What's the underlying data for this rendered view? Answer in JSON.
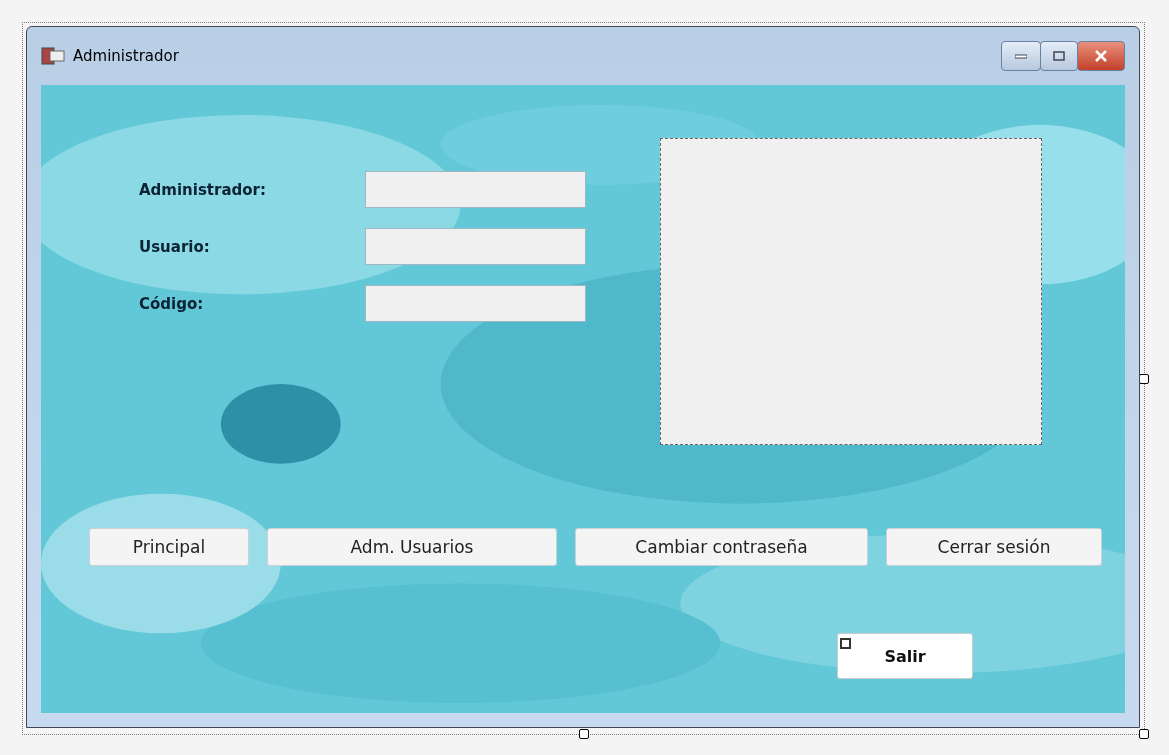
{
  "window": {
    "title": "Administrador"
  },
  "fields": [
    {
      "label": "Administrador:"
    },
    {
      "label": "Usuario:"
    },
    {
      "label": "Código:"
    }
  ],
  "nav_buttons": [
    {
      "label": "Principal"
    },
    {
      "label": "Adm. Usuarios"
    },
    {
      "label": "Cambiar contraseña"
    },
    {
      "label": "Cerrar sesión"
    }
  ],
  "exit_button": {
    "label": "Salir"
  }
}
